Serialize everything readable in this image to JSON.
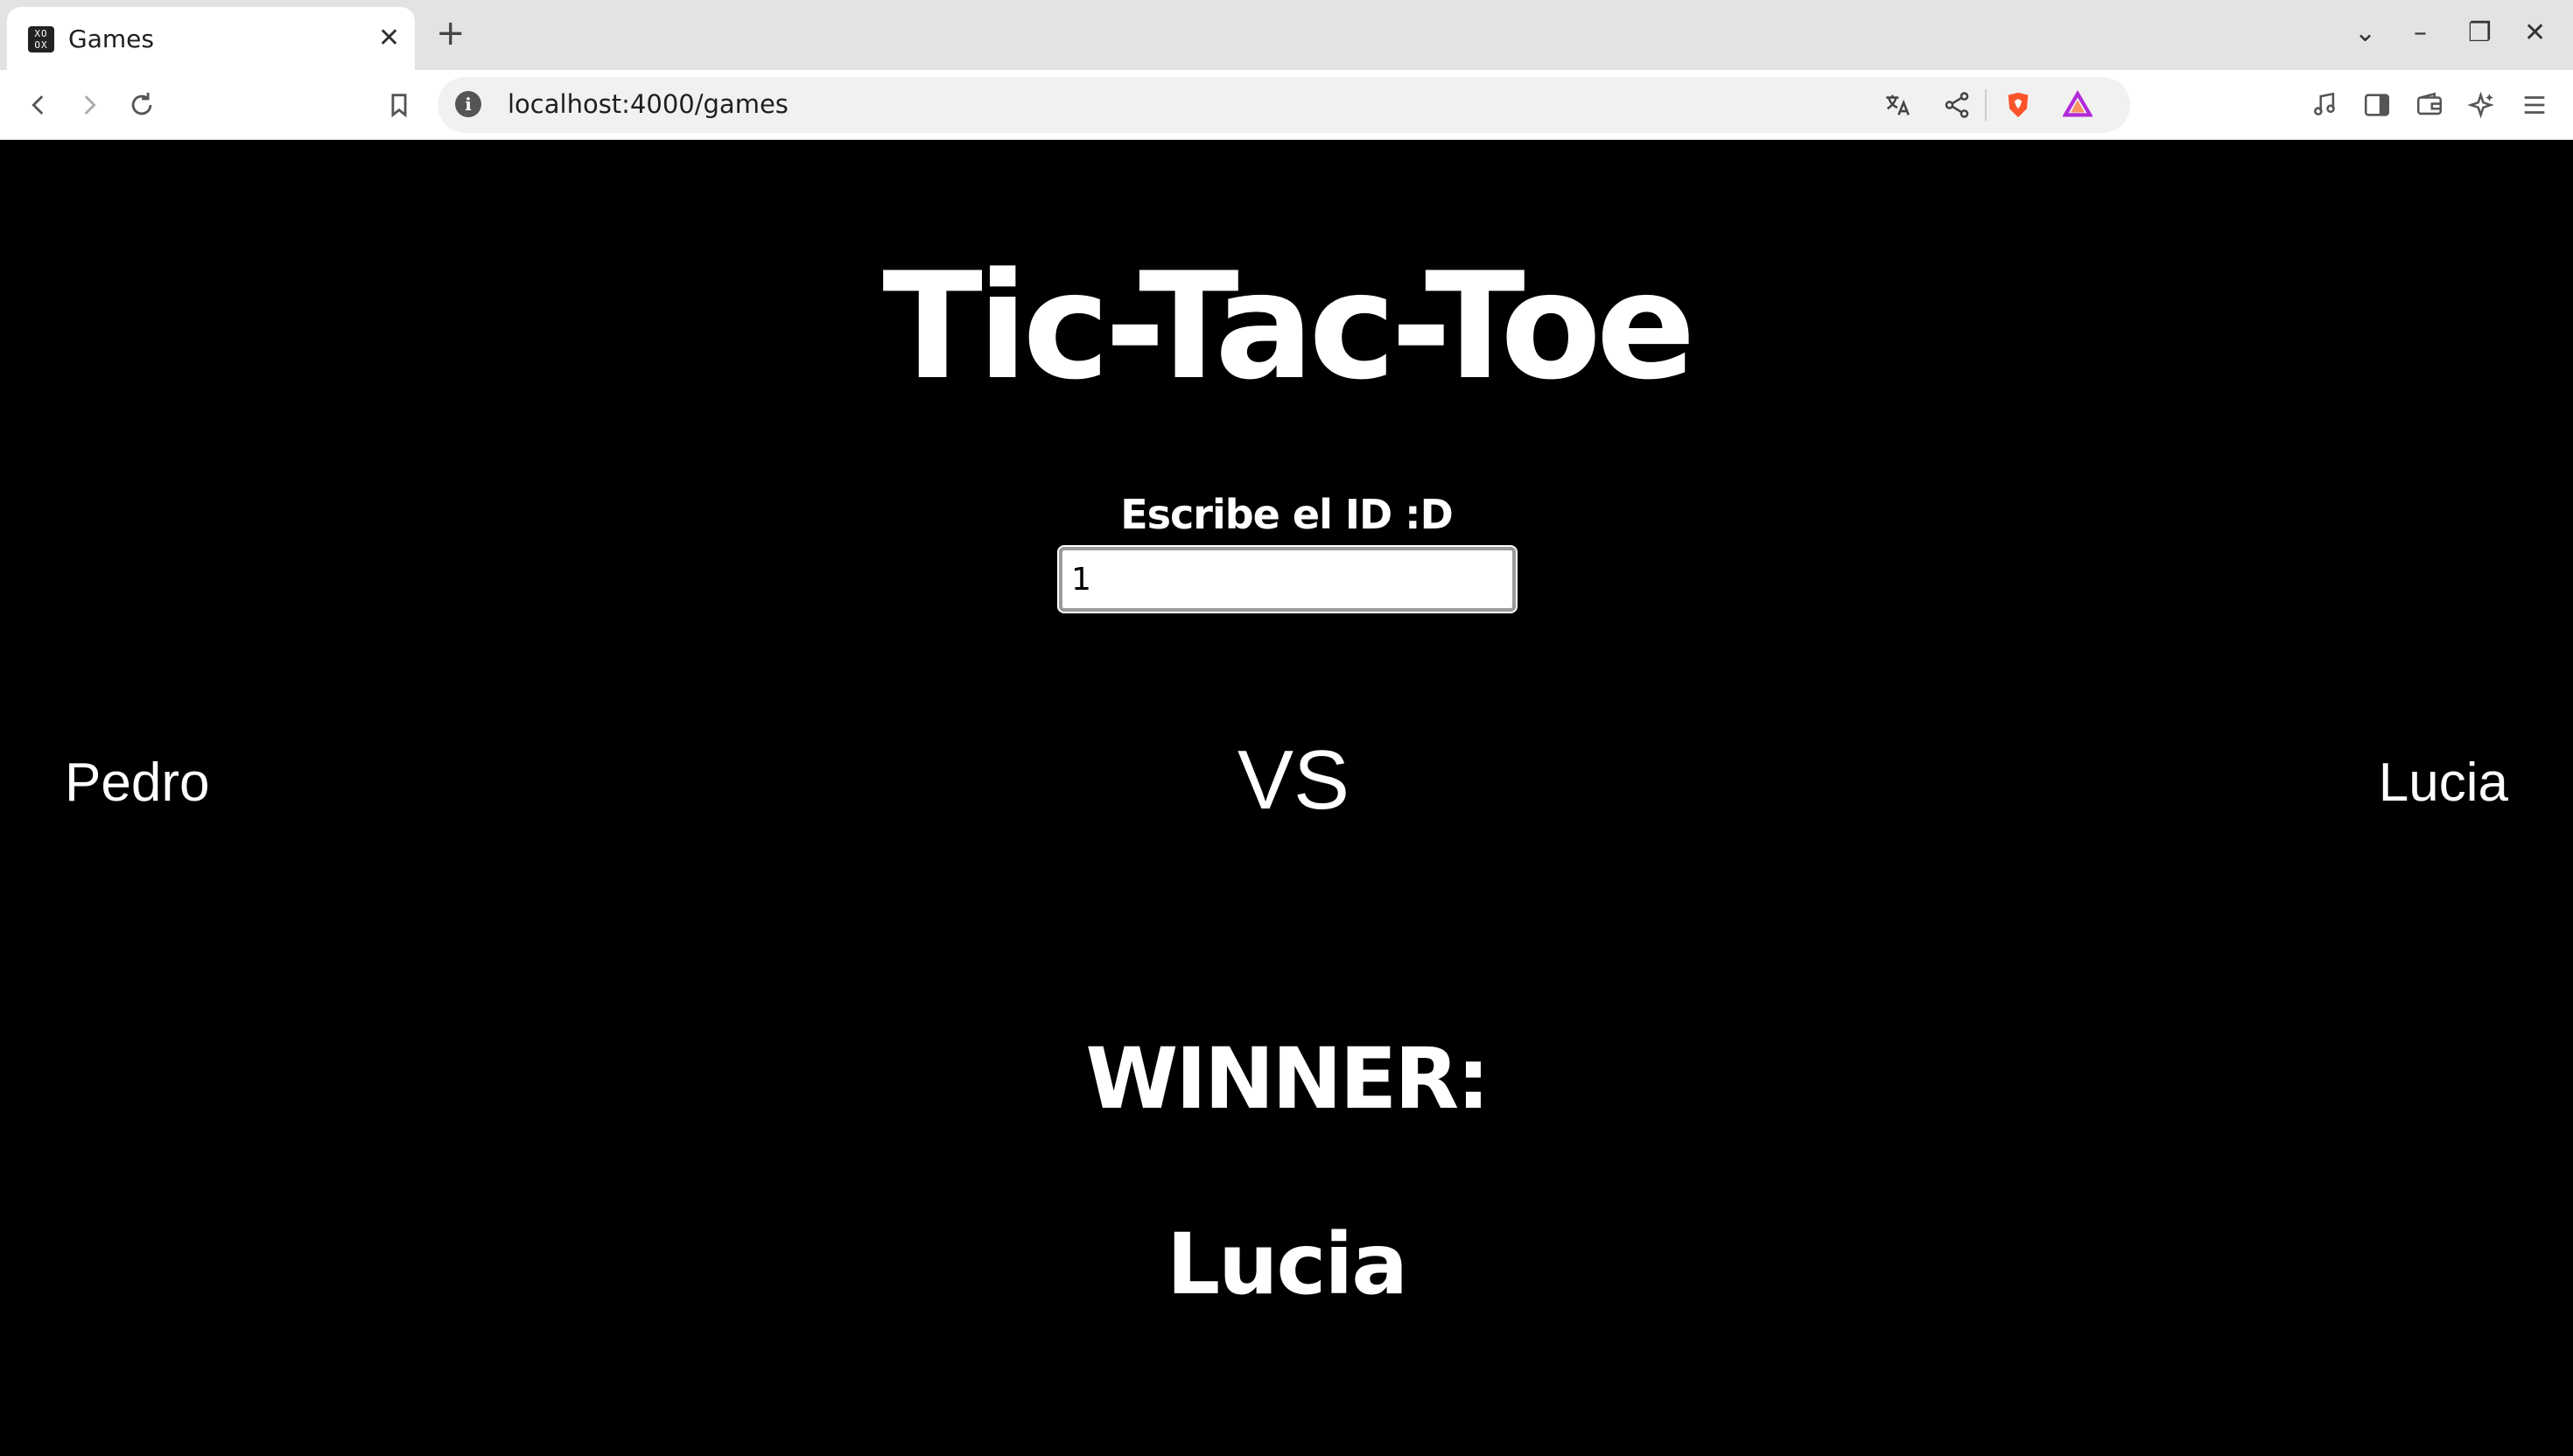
{
  "browser": {
    "tab": {
      "title": "Games",
      "favicon_icon": "xo-grid-icon",
      "favicon_text": "XO OX"
    },
    "url": "localhost:4000/games",
    "icons": {
      "back": "arrow-left-icon",
      "forward": "arrow-right-icon",
      "reload": "reload-icon",
      "bookmark": "bookmark-icon",
      "translate": "translate-icon",
      "share": "share-icon",
      "brave": "brave-shield-icon",
      "rewards": "brave-rewards-icon",
      "media": "music-note-icon",
      "sidebar": "sidebar-icon",
      "wallet": "wallet-icon",
      "leo": "leo-ai-icon",
      "menu": "hamburger-menu-icon"
    }
  },
  "page": {
    "title": "Tic-Tac-Toe",
    "id_label": "Escribe el ID :D",
    "id_value": "1",
    "player_left": "Pedro",
    "vs": "VS",
    "player_right": "Lucia",
    "winner_label": "WINNER:",
    "winner_name": "Lucia"
  },
  "colors": {
    "page_background": "#000000",
    "text": "#ffffff",
    "brave_accent": "#fb542b"
  }
}
